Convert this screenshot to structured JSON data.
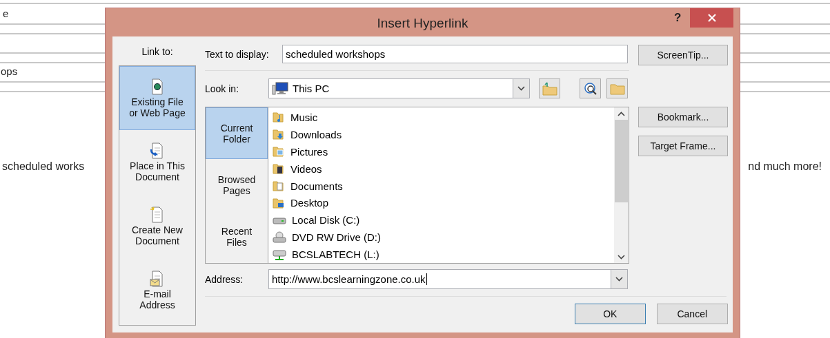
{
  "document": {
    "table_cells": [
      "e",
      "ops"
    ],
    "paragraph_left": "scheduled works",
    "paragraph_right": "nd much more!"
  },
  "dialog": {
    "title": "Insert Hyperlink",
    "help": "?",
    "link_to": {
      "label": "Link to:",
      "items": [
        {
          "label": "Existing File\nor Web Page",
          "kind": "web",
          "selected": true
        },
        {
          "label": "Place in This\nDocument",
          "kind": "place",
          "selected": false
        },
        {
          "label": "Create New\nDocument",
          "kind": "new",
          "selected": false
        },
        {
          "label": "E-mail\nAddress",
          "kind": "mail",
          "selected": false
        }
      ]
    },
    "text_to_display": {
      "label": "Text to display:",
      "value": "scheduled workshops"
    },
    "look_in": {
      "label": "Look in:",
      "value": "This PC"
    },
    "places": [
      {
        "label": "Current\nFolder",
        "selected": true
      },
      {
        "label": "Browsed\nPages",
        "selected": false
      },
      {
        "label": "Recent\nFiles",
        "selected": false
      }
    ],
    "files": [
      {
        "name": "Music",
        "kind": "music"
      },
      {
        "name": "Downloads",
        "kind": "downloads"
      },
      {
        "name": "Pictures",
        "kind": "pictures"
      },
      {
        "name": "Videos",
        "kind": "videos"
      },
      {
        "name": "Documents",
        "kind": "documents"
      },
      {
        "name": "Desktop",
        "kind": "desktop"
      },
      {
        "name": "Local Disk (C:)",
        "kind": "disk"
      },
      {
        "name": "DVD RW Drive (D:)",
        "kind": "dvd"
      },
      {
        "name": "BCSLABTECH (L:)",
        "kind": "network"
      }
    ],
    "address": {
      "label": "Address:",
      "value": "http://www.bcslearningzone.co.uk"
    },
    "side_buttons": [
      "ScreenTip...",
      "Bookmark...",
      "Target Frame..."
    ],
    "buttons": [
      {
        "label": "OK",
        "default": true
      },
      {
        "label": "Cancel",
        "default": false
      }
    ]
  }
}
